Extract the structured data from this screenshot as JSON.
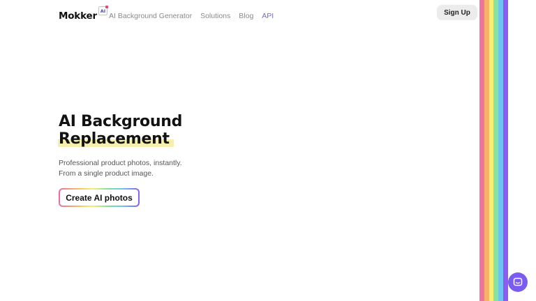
{
  "header": {
    "logo_text": "Mokker",
    "logo_badge": "AI",
    "nav": [
      {
        "label": "AI Background Generator"
      },
      {
        "label": "Solutions"
      },
      {
        "label": "Blog"
      },
      {
        "label": "API"
      }
    ],
    "signup_label": "Sign Up"
  },
  "hero": {
    "title_line1": "AI Background",
    "title_line2": "Replacement",
    "subtitle_line1": "Professional product photos, instantly.",
    "subtitle_line2": "From a single product image.",
    "cta_label": "Create AI photos"
  },
  "colors": {
    "accent": "#7b5cf0",
    "highlight": "#f5efb0",
    "rainbow": [
      "#f0739e",
      "#f7b26a",
      "#f6ef72",
      "#86e49c",
      "#6ec3ef",
      "#8a5cf3"
    ]
  },
  "icons": {
    "chat": "chat-bubble-icon"
  }
}
